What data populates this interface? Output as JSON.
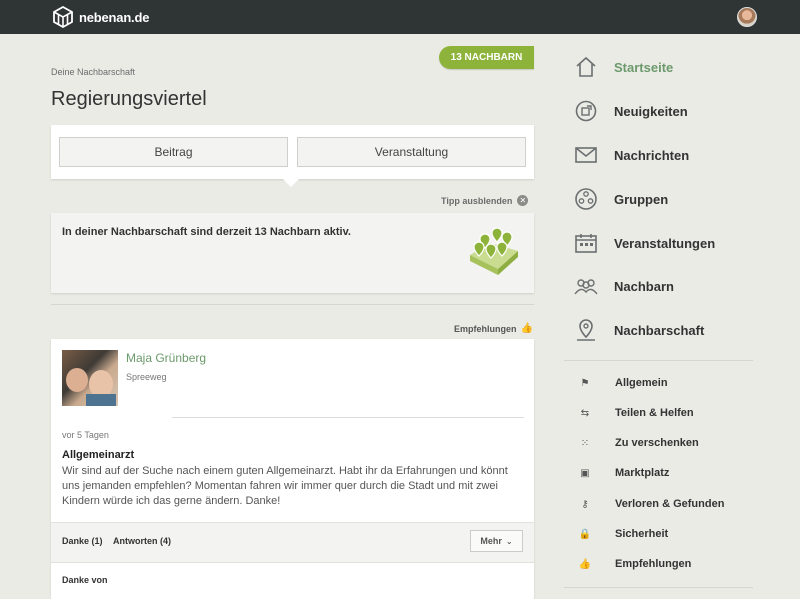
{
  "header": {
    "logo_text": "nebenan.de"
  },
  "main": {
    "members_badge": "13 NACHBARN",
    "breadcrumb": "Deine Nachbarschaft",
    "title": "Regierungsviertel",
    "composer": {
      "post_button": "Beitrag",
      "event_button": "Veranstaltung"
    },
    "tip": {
      "hide_label": "Tipp ausblenden",
      "text": "In deiner Nachbarschaft sind derzeit 13 Nachbarn aktiv."
    },
    "feed_filter_label": "Empfehlungen",
    "post": {
      "author": "Maja Grünberg",
      "street": "Spreeweg",
      "time": "vor 5 Tagen",
      "title": "Allgemeinarzt",
      "body": "Wir sind auf der Suche nach einem guten Allgemeinarzt. Habt ihr da Erfahrungen und könnt uns jemanden empfehlen? Momentan fahren wir immer quer durch die Stadt und mit zwei Kindern würde ich das gerne ändern. Danke!",
      "thanks": "Danke (1)",
      "replies": "Antworten (4)",
      "more": "Mehr",
      "thanks_from": "Danke von"
    }
  },
  "sidebar": {
    "nav": [
      {
        "label": "Startseite",
        "icon": "home-icon",
        "active": true
      },
      {
        "label": "Neuigkeiten",
        "icon": "news-icon"
      },
      {
        "label": "Nachrichten",
        "icon": "envelope-icon"
      },
      {
        "label": "Gruppen",
        "icon": "groups-icon"
      },
      {
        "label": "Veranstaltungen",
        "icon": "calendar-icon"
      },
      {
        "label": "Nachbarn",
        "icon": "neighbors-icon"
      },
      {
        "label": "Nachbarschaft",
        "icon": "map-pin-icon"
      }
    ],
    "categories": [
      {
        "label": "Allgemein",
        "icon": "flag-icon"
      },
      {
        "label": "Teilen & Helfen",
        "icon": "share-arrows-icon"
      },
      {
        "label": "Zu verschenken",
        "icon": "gift-icon"
      },
      {
        "label": "Marktplatz",
        "icon": "shop-icon"
      },
      {
        "label": "Verloren & Gefunden",
        "icon": "key-icon"
      },
      {
        "label": "Sicherheit",
        "icon": "lock-icon"
      },
      {
        "label": "Empfehlungen",
        "icon": "thumbs-up-icon"
      }
    ]
  },
  "colors": {
    "accent_green": "#8db33a",
    "link_green": "#6c9a6c",
    "topbar": "#2f3435",
    "page_bg": "#ebebe6"
  }
}
